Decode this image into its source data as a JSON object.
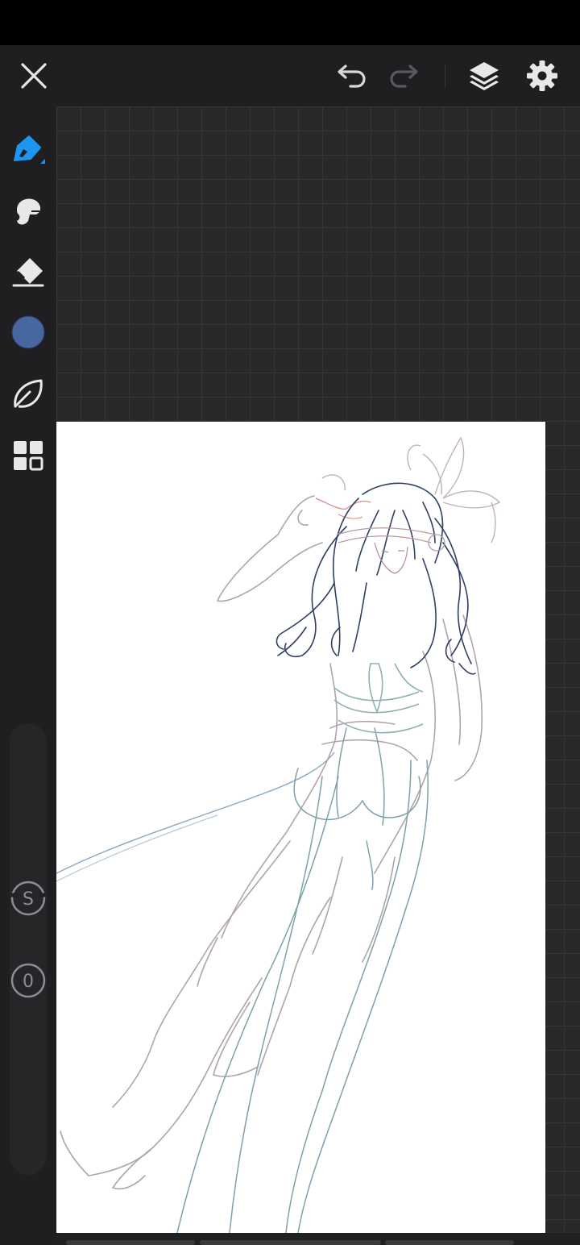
{
  "app": {
    "accent_color": "#1e96f0",
    "current_color": "#46679f"
  },
  "toolbar": {
    "close_icon": "close-icon",
    "undo_icon": "undo-icon",
    "redo_icon": "redo-icon",
    "layers_icon": "layers-icon",
    "settings_icon": "gear-icon"
  },
  "sidebar": {
    "tools": [
      {
        "name": "pen",
        "icon": "pen-icon",
        "active": true
      },
      {
        "name": "smudge",
        "icon": "smudge-icon",
        "active": false
      },
      {
        "name": "eraser",
        "icon": "eraser-icon",
        "active": false
      },
      {
        "name": "color",
        "icon": "color-swatch",
        "active": false
      },
      {
        "name": "brush-library",
        "icon": "leaf-icon",
        "active": false
      },
      {
        "name": "grid-menu",
        "icon": "grid-icon",
        "active": false
      }
    ],
    "size_value": "S",
    "opacity_value": "0"
  }
}
